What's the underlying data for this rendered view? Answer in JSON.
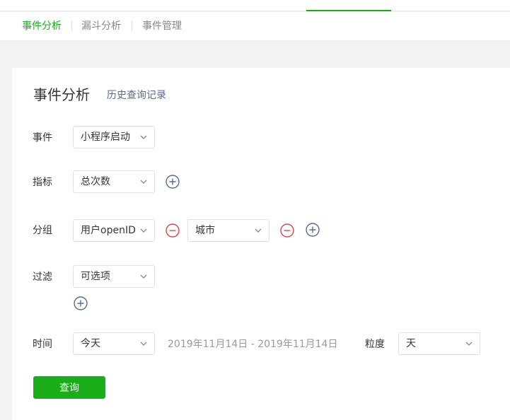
{
  "sub_tabs": [
    {
      "label": "事件分析",
      "active": true
    },
    {
      "label": "漏斗分析",
      "active": false
    },
    {
      "label": "事件管理",
      "active": false
    }
  ],
  "page": {
    "title": "事件分析",
    "history_link": "历史查询记录"
  },
  "form": {
    "event": {
      "label": "事件",
      "value": "小程序启动"
    },
    "metric": {
      "label": "指标",
      "value": "总次数"
    },
    "group": {
      "label": "分组",
      "values": [
        "用户openID",
        "城市"
      ]
    },
    "filter": {
      "label": "过滤",
      "value": "可选项"
    },
    "time": {
      "label": "时间",
      "value": "今天",
      "range": "2019年11月14日 - 2019年11月14日",
      "granularity_label": "粒度",
      "granularity_value": "天"
    },
    "query_button": "查询"
  },
  "colors": {
    "accent": "#1aad19",
    "link": "#576b95",
    "remove": "#e64340",
    "add": "#576b95"
  },
  "icons": {
    "chevron": "chevron-down-icon",
    "add": "plus-circle-icon",
    "remove": "minus-circle-icon"
  }
}
